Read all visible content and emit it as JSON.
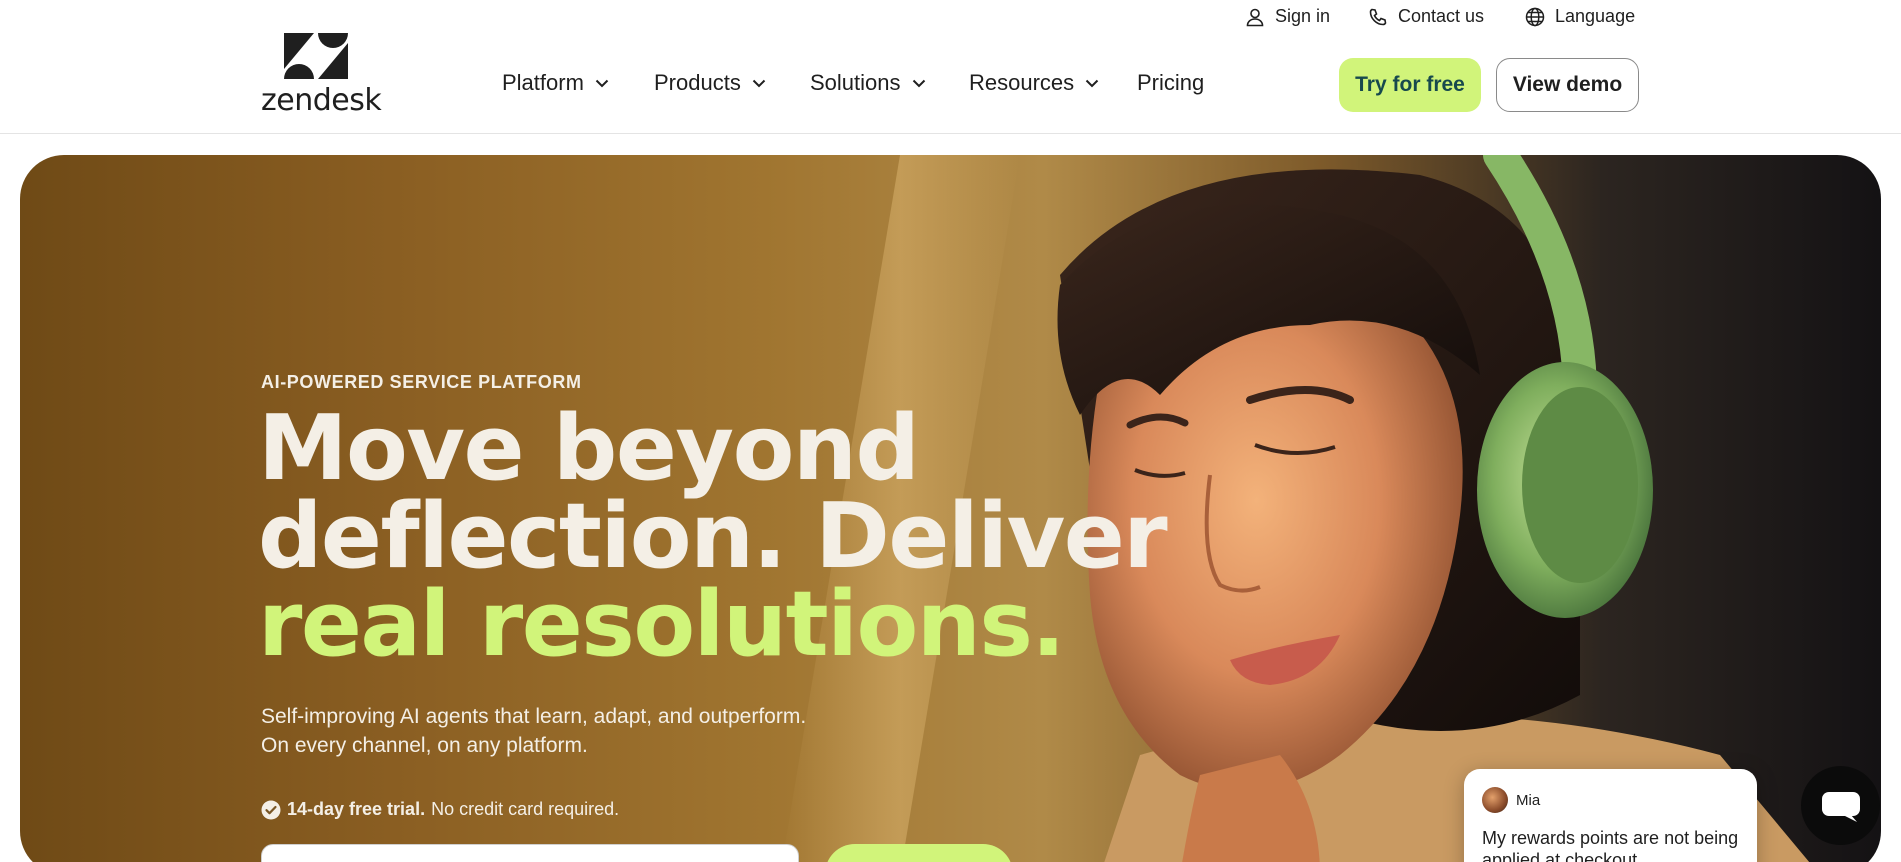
{
  "utility": {
    "sign_in": "Sign in",
    "contact_us": "Contact us",
    "language": "Language"
  },
  "brand": {
    "wordmark": "zendesk"
  },
  "nav": {
    "items": [
      {
        "label": "Platform",
        "has_dropdown": true
      },
      {
        "label": "Products",
        "has_dropdown": true
      },
      {
        "label": "Solutions",
        "has_dropdown": true
      },
      {
        "label": "Resources",
        "has_dropdown": true
      },
      {
        "label": "Pricing",
        "has_dropdown": false
      }
    ],
    "try_label": "Try for free",
    "demo_label": "View demo"
  },
  "hero": {
    "eyebrow": "AI-POWERED SERVICE PLATFORM",
    "headline_line1": "Move beyond",
    "headline_line2": "deflection. Deliver",
    "headline_accent": "real resolutions.",
    "sub_line1": "Self-improving AI agents that learn, adapt, and outperform.",
    "sub_line2": "On every channel, on any platform.",
    "trial_bold": "14-day free trial.",
    "trial_rest": "No credit card required."
  },
  "chat": {
    "agent_name": "Mia",
    "message": "My rewards points are not being applied at checkout"
  },
  "colors": {
    "accent_lime": "#d1f47a",
    "brand_dark": "#17494d",
    "hero_text": "#f4efe6"
  },
  "icons": {
    "sign_in": "user-icon",
    "contact": "phone-icon",
    "language": "globe-icon",
    "dropdown": "chevron-down-icon",
    "trial": "check-circle-icon",
    "chat": "chat-bubble-icon"
  }
}
